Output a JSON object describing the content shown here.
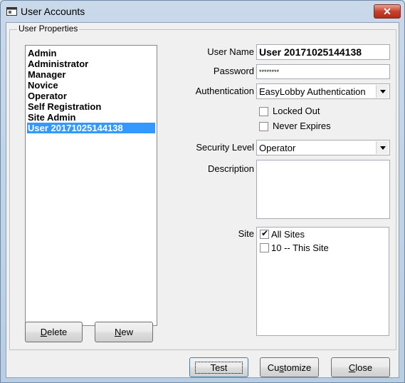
{
  "window": {
    "title": "User Accounts",
    "close_glyph": "✕",
    "icon": "window-icon"
  },
  "group": {
    "label": "User Properties"
  },
  "users": [
    {
      "name": "Admin",
      "selected": false
    },
    {
      "name": "Administrator",
      "selected": false
    },
    {
      "name": "Manager",
      "selected": false
    },
    {
      "name": "Novice",
      "selected": false
    },
    {
      "name": "Operator",
      "selected": false
    },
    {
      "name": "Self Registration",
      "selected": false
    },
    {
      "name": "Site Admin",
      "selected": false
    },
    {
      "name": "User 20171025144138",
      "selected": true
    }
  ],
  "buttons": {
    "delete": {
      "pre": "",
      "ul": "D",
      "post": "elete"
    },
    "new": {
      "pre": "",
      "ul": "N",
      "post": "ew"
    },
    "test": {
      "label": "Test"
    },
    "customize": {
      "pre": "Cu",
      "ul": "s",
      "post": "tomize"
    },
    "close": {
      "pre": "",
      "ul": "C",
      "post": "lose"
    }
  },
  "form": {
    "user_name_label": "User Name",
    "user_name_value": "User 20171025144138",
    "password_label": "Password",
    "password_value": "********",
    "authentication_label": "Authentication",
    "authentication_value": "EasyLobby Authentication",
    "locked_out_label": "Locked Out",
    "locked_out_checked": false,
    "never_expires_label": "Never Expires",
    "never_expires_checked": false,
    "security_level_label": "Security Level",
    "security_level_value": "Operator",
    "description_label": "Description",
    "description_value": "",
    "site_label": "Site"
  },
  "sites": [
    {
      "label": "All Sites",
      "checked": true
    },
    {
      "label": "10 -- This Site",
      "checked": false
    }
  ],
  "colors": {
    "selection": "#3399ff",
    "close_button": "#c6412d"
  }
}
